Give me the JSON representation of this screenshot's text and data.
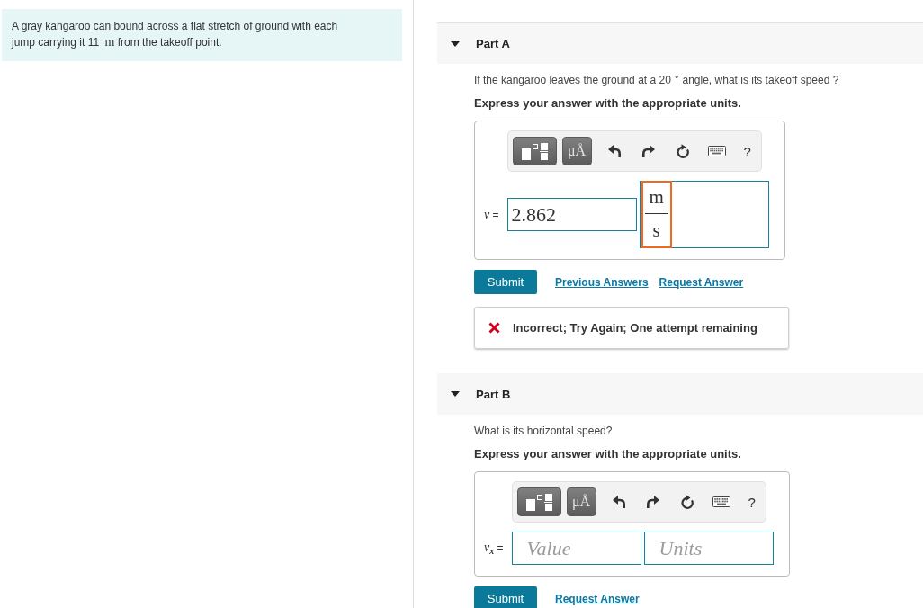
{
  "problem": {
    "segments": [
      {
        "kind": "text",
        "text": "A gray kangaroo can bound across a flat stretch of ground with each jump carrying it 11"
      },
      {
        "kind": "math",
        "text": "m"
      },
      {
        "kind": "text",
        "text": "from the takeoff point."
      }
    ]
  },
  "parts": [
    {
      "title": "Part A",
      "expanded": true,
      "question": "If the kangaroo leaves the ground at a 20 $^{∘}$ angle, what is its takeoff speed ?",
      "instruction": "Express your answer with the appropriate units.",
      "toolbar": [
        {
          "kind": "templates"
        },
        {
          "kind": "units",
          "label": "μÅ"
        },
        {
          "kind": "undo"
        },
        {
          "kind": "redo"
        },
        {
          "kind": "reset"
        },
        {
          "kind": "keyboard"
        },
        {
          "kind": "help",
          "label": "?"
        }
      ],
      "answer": {
        "label": "*v* =",
        "value_field": {
          "value": "2.862"
        },
        "units_field": {
          "kind": "fraction",
          "numerator": "m",
          "denominator": "s",
          "highlighted": true
        }
      },
      "actions": [
        {
          "kind": "submit",
          "label": "Submit"
        },
        {
          "kind": "link",
          "label": "Previous Answers"
        },
        {
          "kind": "link",
          "label": "Request Answer"
        }
      ],
      "feedback": {
        "correct": false,
        "text": "Incorrect; Try Again; One attempt remaining"
      }
    },
    {
      "title": "Part B",
      "expanded": true,
      "question": "What is its horizontal speed?",
      "instruction": "Express your answer with the appropriate units.",
      "toolbar": [
        {
          "kind": "templates"
        },
        {
          "kind": "units",
          "label": "μÅ"
        },
        {
          "kind": "undo"
        },
        {
          "kind": "redo"
        },
        {
          "kind": "reset"
        },
        {
          "kind": "keyboard"
        },
        {
          "kind": "help",
          "label": "?"
        }
      ],
      "answer": {
        "label": "*v*$_{x}$ =",
        "value_field": {
          "placeholder": "Value"
        },
        "units_field": {
          "kind": "input",
          "placeholder": "Units"
        }
      },
      "actions": [
        {
          "kind": "submit",
          "label": "Submit"
        },
        {
          "kind": "link",
          "label": "Request Answer"
        }
      ]
    }
  ]
}
